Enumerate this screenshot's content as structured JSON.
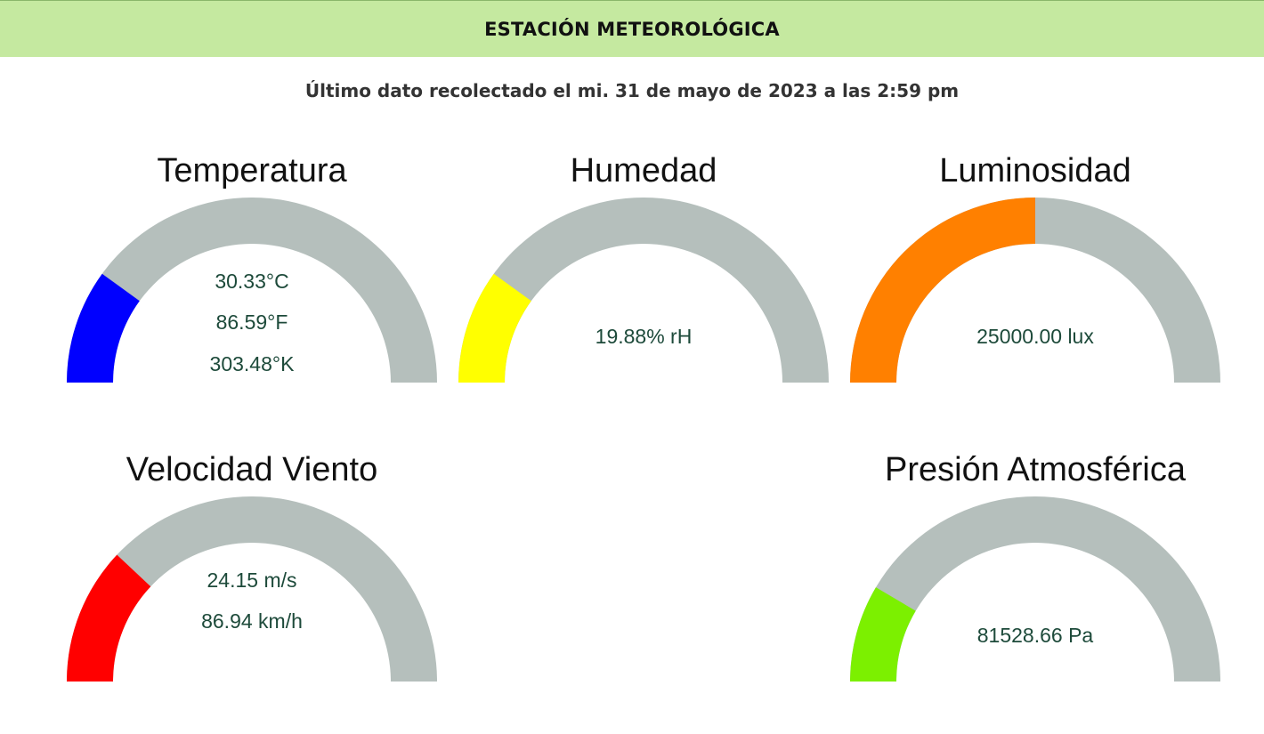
{
  "header": {
    "title": "ESTACIÓN METEOROLÓGICA"
  },
  "last_update": "Último dato recolectado el mi. 31 de mayo de 2023 a las 2:59 pm",
  "colors": {
    "header_bg": "#c5e9a0",
    "track": "#b5bfbc",
    "value_text": "#1d4a3a"
  },
  "gauges": {
    "temperatura": {
      "title": "Temperatura",
      "fraction": 0.2,
      "color": "#0000ff",
      "values": [
        "30.33°C",
        "86.59°F",
        "303.48°K"
      ]
    },
    "humedad": {
      "title": "Humedad",
      "fraction": 0.2,
      "color": "#ffff00",
      "values": [
        "19.88% rH"
      ]
    },
    "luminosidad": {
      "title": "Luminosidad",
      "fraction": 0.5,
      "color": "#ff8000",
      "values": [
        "25000.00 lux"
      ]
    },
    "viento": {
      "title": "Velocidad Viento",
      "fraction": 0.24,
      "color": "#ff0000",
      "values": [
        "24.15 m/s",
        "86.94 km/h"
      ]
    },
    "presion": {
      "title": "Presión Atmosférica",
      "fraction": 0.17,
      "color": "#7cf000",
      "values": [
        "81528.66 Pa"
      ]
    }
  }
}
